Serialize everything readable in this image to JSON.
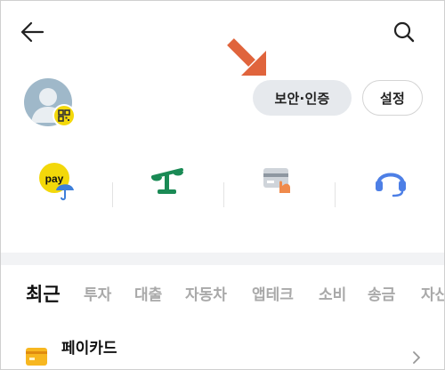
{
  "header": {
    "back_icon": "back-arrow-icon",
    "search_icon": "search-icon"
  },
  "profile": {
    "avatar_icon": "default-avatar-icon",
    "badge_icon": "qr-code-icon",
    "security_label": "보안·인증",
    "settings_label": "설정",
    "annotation_color": "#e0643c"
  },
  "quick_menu": [
    {
      "icon": "kakao-pay-umbrella-icon",
      "pay_text": "pay"
    },
    {
      "icon": "scale-icon"
    },
    {
      "icon": "card-hand-icon"
    },
    {
      "icon": "headset-support-icon"
    }
  ],
  "tabs": [
    {
      "label": "최근",
      "active": true
    },
    {
      "label": "투자"
    },
    {
      "label": "대출"
    },
    {
      "label": "자동차"
    },
    {
      "label": "앱테크"
    },
    {
      "label": "소비"
    },
    {
      "label": "송금"
    },
    {
      "label": "자산"
    }
  ],
  "recent_list": [
    {
      "title": "페이카드",
      "icon": "card-icon"
    }
  ],
  "colors": {
    "accent_yellow": "#f3d80a",
    "green": "#1a8a55",
    "blue": "#4d7fe6"
  }
}
